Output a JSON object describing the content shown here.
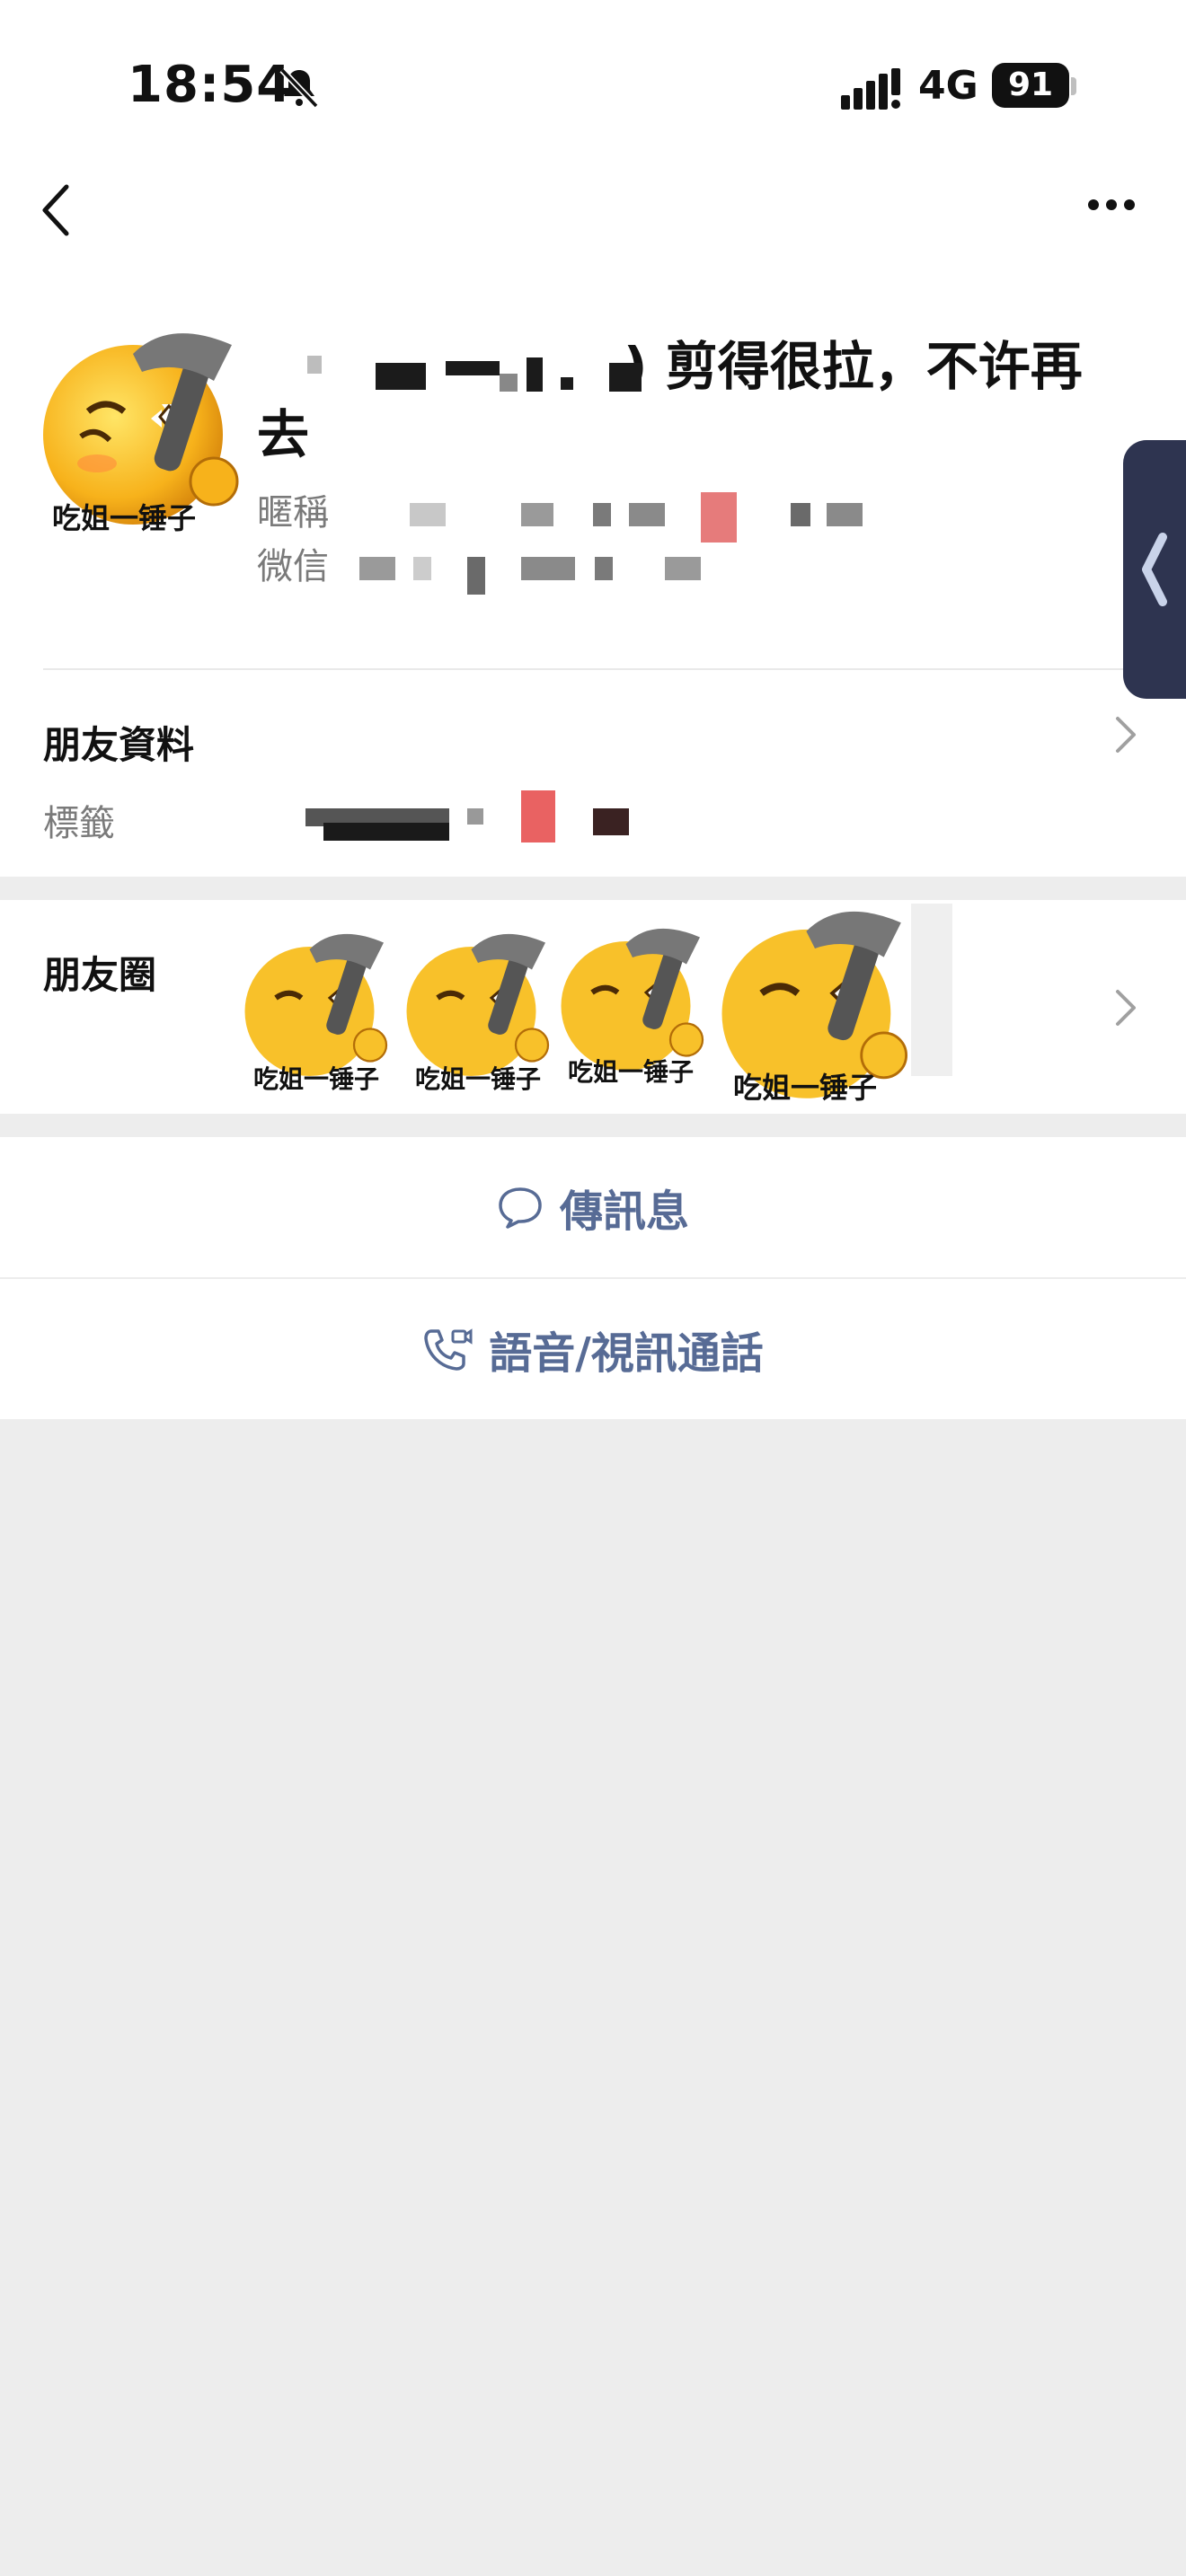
{
  "status_bar": {
    "time": "18:54",
    "network": "4G",
    "battery": "91",
    "icons": [
      "bell-slash-icon",
      "signal-icon",
      "battery-icon"
    ]
  },
  "nav": {
    "back_icon": "chevron-left-icon",
    "more_icon": "more-dots-icon"
  },
  "profile": {
    "avatar_caption": "吃姐一锤子",
    "name_suffix": ") 剪得很拉，不许再去",
    "nickname_label": "暱稱",
    "wechat_label": "微信"
  },
  "friend_info": {
    "title": "朋友資料",
    "tag_label": "標籤"
  },
  "moments": {
    "title": "朋友圈",
    "thumb_captions": [
      "吃姐一锤子",
      "吃姐一锤子",
      "吃姐一锤子",
      "吃姐一锤子"
    ]
  },
  "actions": {
    "message": "傳訊息",
    "call": "語音/視訊通話"
  },
  "colors": {
    "link": "#576b95",
    "background": "#ededed",
    "side_tab": "#2e3450"
  }
}
